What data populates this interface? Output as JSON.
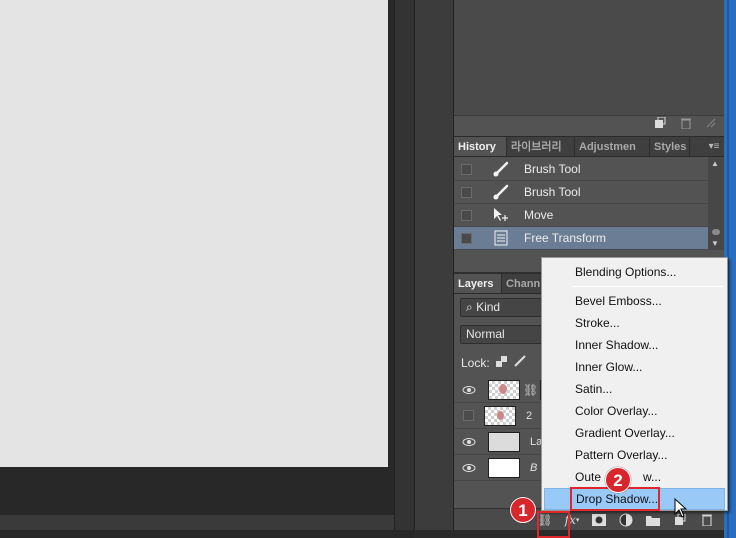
{
  "history": {
    "tabs": [
      "History",
      "라이브러리",
      "Adjustmen",
      "Styles"
    ],
    "items": [
      {
        "label": "Brush Tool",
        "icon": "brush-icon",
        "selected": false
      },
      {
        "label": "Brush Tool",
        "icon": "brush-icon",
        "selected": false
      },
      {
        "label": "Move",
        "icon": "move-tool-icon",
        "selected": false
      },
      {
        "label": "Free Transform",
        "icon": "document-icon",
        "selected": true
      }
    ]
  },
  "layers": {
    "tabs": [
      "Layers",
      "Chann"
    ],
    "filter_label": "Kind",
    "blend_mode": "Normal",
    "lock_label": "Lock:",
    "rows": [
      {
        "name": "",
        "visible": true
      },
      {
        "name": "2",
        "visible": false
      },
      {
        "name": "La",
        "visible": true
      },
      {
        "name": "B",
        "visible": true
      }
    ]
  },
  "context_menu": {
    "items": [
      "Blending Options...",
      "Bevel  Emboss...",
      "Stroke...",
      "Inner Shadow...",
      "Inner Glow...",
      "Satin...",
      "Color Overlay...",
      "Gradient Overlay...",
      "Pattern Overlay...",
      "Outer Glow...",
      "Drop Shadow..."
    ],
    "visible_outer_glow": "Oute",
    "visible_outer_glow_tail": "w...",
    "highlighted": "Drop Shadow..."
  },
  "footer": {
    "fx_label": "fx"
  },
  "annotations": {
    "step1": "1",
    "step2": "2",
    "color": "#d8262d"
  }
}
